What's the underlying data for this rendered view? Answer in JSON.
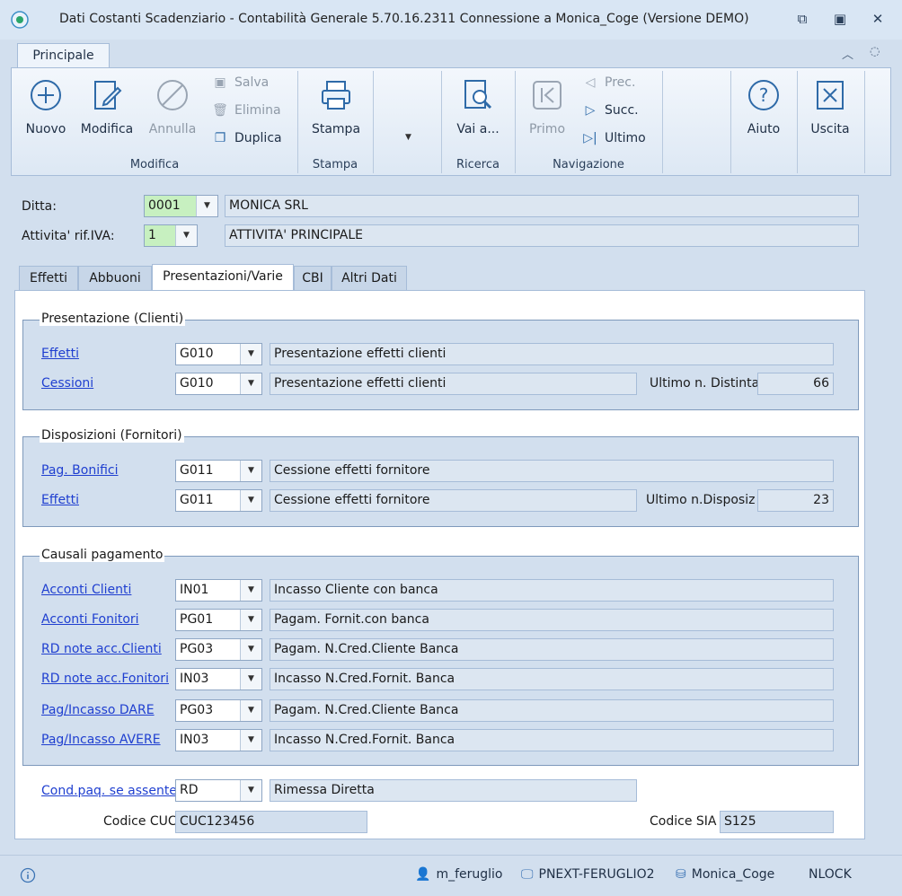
{
  "window": {
    "title": "Dati Costanti Scadenziario - Contabilità Generale 5.70.16.2311  Connessione a Monica_Coge (Versione DEMO)"
  },
  "ribbon": {
    "tab": "Principale",
    "groups": {
      "modifica": "Modifica",
      "stampa": "Stampa",
      "ricerca": "Ricerca",
      "navigazione": "Navigazione"
    },
    "buttons": {
      "nuovo": "Nuovo",
      "modifica": "Modifica",
      "annulla": "Annulla",
      "salva": "Salva",
      "elimina": "Elimina",
      "duplica": "Duplica",
      "stampa": "Stampa",
      "vai": "Vai a...",
      "primo": "Primo",
      "prec": "Prec.",
      "succ": "Succ.",
      "ultimo": "Ultimo",
      "aiuto": "Aiuto",
      "uscita": "Uscita"
    }
  },
  "header": {
    "ditta_label": "Ditta:",
    "ditta_code": "0001",
    "ditta_name": "MONICA SRL",
    "attivita_label": "Attivita' rif.IVA:",
    "attivita_code": "1",
    "attivita_name": "ATTIVITA' PRINCIPALE"
  },
  "tabs": [
    "Effetti",
    "Abbuoni",
    "Presentazioni/Varie",
    "CBI",
    "Altri Dati"
  ],
  "presentazione": {
    "title": "Presentazione (Clienti)",
    "rows": [
      {
        "label": "Effetti",
        "code": "G010",
        "desc": "Presentazione effetti clienti"
      },
      {
        "label": "Cessioni",
        "code": "G010",
        "desc": "Presentazione effetti clienti"
      }
    ],
    "ultimo_label": "Ultimo n. Distinta",
    "ultimo_value": "66"
  },
  "disposizioni": {
    "title": "Disposizioni (Fornitori)",
    "rows": [
      {
        "label": "Pag. Bonifici",
        "code": "G011",
        "desc": "Cessione effetti fornitore"
      },
      {
        "label": "Effetti",
        "code": "G011",
        "desc": "Cessione effetti fornitore"
      }
    ],
    "ultimo_label": "Ultimo n.Disposiz",
    "ultimo_value": "23"
  },
  "causali": {
    "title": "Causali pagamento",
    "rows": [
      {
        "label": "Acconti Clienti ",
        "code": "IN01",
        "desc": "Incasso Cliente con banca"
      },
      {
        "label": "Acconti Fonitori ",
        "code": "PG01",
        "desc": "Pagam. Fornit.con banca"
      },
      {
        "label": "RD note acc.Clienti ",
        "code": "PG03",
        "desc": "Pagam. N.Cred.Cliente Banca"
      },
      {
        "label": "RD note acc.Fonitori ",
        "code": "IN03",
        "desc": "Incasso N.Cred.Fornit. Banca"
      },
      {
        "label": "Pag/Incasso DARE",
        "code": "PG03",
        "desc": "Pagam. N.Cred.Cliente Banca"
      },
      {
        "label": "Pag/Incasso AVERE",
        "code": "IN03",
        "desc": "Incasso N.Cred.Fornit. Banca"
      }
    ]
  },
  "footer_fields": {
    "cond_label": "Cond.paq. se assente",
    "cond_code": "RD",
    "cond_desc": "Rimessa Diretta",
    "cuc_label": "Codice CUC",
    "cuc_value": "CUC123456",
    "sia_label": "Codice SIA",
    "sia_value": "S125"
  },
  "status": {
    "user": "m_feruglio",
    "machine": "PNEXT-FERUGLIO2",
    "database": "Monica_Coge",
    "lock": "NLOCK"
  },
  "icons": [
    "app-icon",
    "plus-circle-icon",
    "pencil-icon",
    "cancel-circle-icon",
    "save-icon",
    "trash-icon",
    "duplicate-icon",
    "printer-icon",
    "search-icon",
    "first-icon",
    "prev-icon",
    "next-icon",
    "last-icon",
    "help-icon",
    "close-box-icon",
    "user-icon",
    "monitor-icon",
    "database-icon",
    "info-icon"
  ],
  "colors": {
    "accent": "#2e6aa8",
    "link": "#1f3fd0",
    "key_field": "#c7f0c0"
  }
}
